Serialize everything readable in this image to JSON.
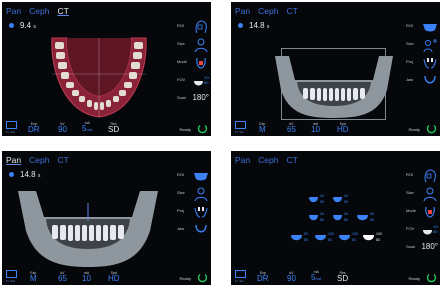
{
  "tabs": [
    "Pan",
    "Ceph",
    "CT"
  ],
  "panels": [
    {
      "timer": "9.4",
      "unit": "s",
      "side": [
        {
          "label": "ROI",
          "icon": "head-outline-icon"
        },
        {
          "label": "Size",
          "icon": "person-outline-icon"
        },
        {
          "label": "Mode",
          "icon": "tooth-mode-icon"
        },
        {
          "label": "FOV",
          "icon": "fov-dome-icon",
          "extra": "100\n80"
        },
        {
          "label": "Scan",
          "value": "180°"
        }
      ],
      "bottom": [
        {
          "label": "Exp",
          "value": "DR"
        },
        {
          "label": "kV",
          "value": "90"
        },
        {
          "label": "mA",
          "value": "5",
          "unit": "mA"
        },
        {
          "label": "Res",
          "value": "SD"
        }
      ],
      "ready_label": "Ready"
    },
    {
      "timer": "14.8",
      "unit": "s",
      "side": [
        {
          "label": "ROI",
          "icon": "jaw-band-icon"
        },
        {
          "label": "Size",
          "icon": "person-child-icon"
        },
        {
          "label": "Proj",
          "icon": "teeth-proj-icon"
        },
        {
          "label": "Jaw",
          "icon": "jaw-arch-icon"
        }
      ],
      "bottom": [
        {
          "label": "Exp",
          "value": "M"
        },
        {
          "label": "kV",
          "value": "65"
        },
        {
          "label": "mA",
          "value": "10"
        },
        {
          "label": "Spd",
          "value": "HD"
        }
      ],
      "ready_label": "Ready"
    },
    {
      "timer": "14.8",
      "unit": "s",
      "side": [
        {
          "label": "ROI",
          "icon": "jaw-band-icon"
        },
        {
          "label": "Size",
          "icon": "person-outline-icon"
        },
        {
          "label": "Proj",
          "icon": "teeth-proj-icon"
        },
        {
          "label": "Jaw",
          "icon": "jaw-arch-icon"
        }
      ],
      "bottom": [
        {
          "label": "Exp",
          "value": "M"
        },
        {
          "label": "kV",
          "value": "65"
        },
        {
          "label": "mA",
          "value": "10"
        },
        {
          "label": "Spd",
          "value": "HD"
        }
      ],
      "ready_label": "Ready"
    },
    {
      "side": [
        {
          "label": "ROI",
          "icon": "head-outline-icon"
        },
        {
          "label": "Size",
          "icon": "person-outline-icon"
        },
        {
          "label": "Mode",
          "icon": "tooth-mode-icon"
        },
        {
          "label": "FOV",
          "icon": "fov-dome-icon"
        },
        {
          "label": "Scan",
          "value": "180°"
        }
      ],
      "bottom": [
        {
          "label": "Exp",
          "value": "DR"
        },
        {
          "label": "kV",
          "value": "90"
        },
        {
          "label": "mA",
          "value": "5",
          "unit": "mA"
        },
        {
          "label": "Res",
          "value": "SD"
        }
      ],
      "fov_options": [
        [
          "40",
          "50"
        ],
        [
          "40",
          "50"
        ],
        [
          "40",
          "80"
        ],
        [
          "40",
          "80"
        ],
        [
          "80",
          "80"
        ],
        [
          "80",
          "80"
        ],
        [
          "100",
          "80"
        ],
        [
          "100",
          "80"
        ],
        [
          "100",
          "80"
        ],
        [
          "100",
          "80"
        ]
      ],
      "ready_label": "Ready"
    }
  ],
  "caption_text": "Fr. Sel",
  "colors": {
    "accent": "#3b82f6",
    "tab_active": "#e6e9ef",
    "ready": "#22c55e",
    "gum": "#8b2338",
    "xray": "#8f979e"
  }
}
